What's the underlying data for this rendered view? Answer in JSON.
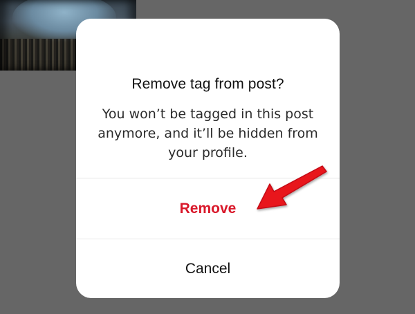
{
  "dialog": {
    "title": "Remove tag from post?",
    "message": "You won’t be tagged in this post anymore, and it’ll be hidden from your profile.",
    "remove_label": "Remove",
    "cancel_label": "Cancel"
  },
  "icons": {
    "annotation_arrow": "red-arrow-icon"
  },
  "colors": {
    "overlay": "#666666",
    "dialog_bg": "#ffffff",
    "destructive": "#d9182a",
    "arrow": "#e8121e"
  }
}
